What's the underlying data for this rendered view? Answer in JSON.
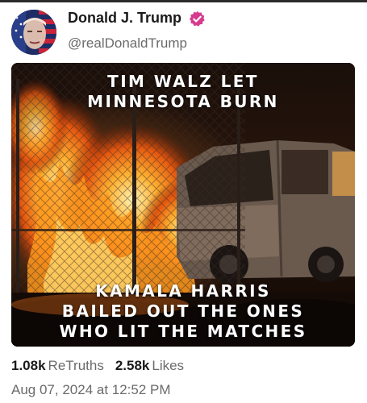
{
  "post": {
    "author": {
      "name": "Donald J. Trump",
      "handle": "@realDonaldTrump",
      "verified": true,
      "verified_color": "#d63b8f",
      "avatar_icon": "flag-portrait-avatar"
    },
    "image": {
      "caption_top": [
        "TIM WALZ LET",
        "MINNESOTA BURN"
      ],
      "caption_bottom": [
        "KAMALA HARRIS",
        "BAILED OUT THE ONES",
        "WHO LIT THE MATCHES"
      ]
    },
    "stats": {
      "retruths_count": "1.08k",
      "retruths_label": "ReTruths",
      "likes_count": "2.58k",
      "likes_label": "Likes"
    },
    "timestamp": "Aug 07, 2024 at 12:52 PM"
  }
}
